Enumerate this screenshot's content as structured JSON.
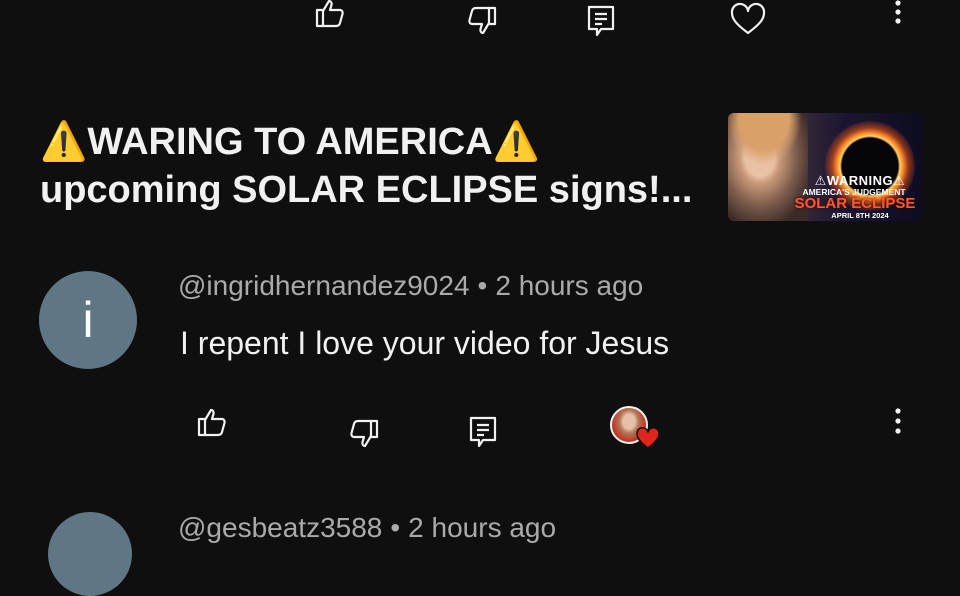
{
  "top_actions": {
    "like_icon": "thumbs-up-icon",
    "dislike_icon": "thumbs-down-icon",
    "reply_icon": "comment-icon",
    "heart_icon": "heart-outline-icon",
    "more_icon": "more-vertical-icon"
  },
  "video": {
    "title_line1": "⚠️WARING TO AMERICA⚠️",
    "title_line2": "upcoming SOLAR ECLIPSE signs!...",
    "thumbnail": {
      "line1": "⚠WARNING⚠",
      "line2": "AMERICA'S JUDGEMENT",
      "line3": "SOLAR ECLIPSE",
      "line4": "APRIL 8TH 2024"
    }
  },
  "comments": [
    {
      "avatar_letter": "i",
      "author": "@ingridhernandez9024",
      "time": "2 hours ago",
      "text": "I repent I love your video for Jesus",
      "creator_hearted": true
    },
    {
      "author": "@gesbeatz3588",
      "time": "2 hours ago"
    }
  ],
  "colors": {
    "background": "#0f0f0f",
    "text_primary": "#f1f1f1",
    "text_secondary": "#aaaaaa",
    "avatar_bg": "#5f7784",
    "heart": "#e0251c"
  }
}
